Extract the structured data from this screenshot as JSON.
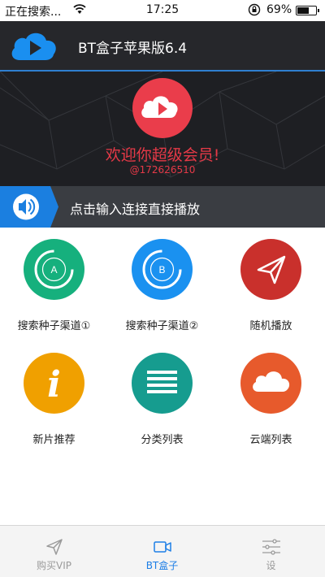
{
  "status_bar": {
    "carrier": "正在搜索...",
    "time": "17:25",
    "battery_text": "69%",
    "battery_level": 0.69
  },
  "header": {
    "title": "BT盒子苹果版6.4",
    "logo_icon": "cloud-play-icon"
  },
  "banner": {
    "welcome": "欢迎你超级会员!",
    "handle": "@172626510",
    "badge_icon": "cloud-play-icon"
  },
  "input_bar": {
    "prompt": "点击输入连接直接播放",
    "icon": "speaker-icon"
  },
  "grid": {
    "items": [
      {
        "label": "搜索种子渠道①",
        "icon": "channel-a-icon",
        "glyph": "A",
        "color": "#16b07d"
      },
      {
        "label": "搜索种子渠道②",
        "icon": "channel-b-icon",
        "glyph": "B",
        "color": "#1a91f0"
      },
      {
        "label": "随机播放",
        "icon": "paper-plane-icon",
        "glyph": "",
        "color": "#c9302c"
      },
      {
        "label": "新片推荐",
        "icon": "info-icon",
        "glyph": "i",
        "color": "#f0a000"
      },
      {
        "label": "分类列表",
        "icon": "list-icon",
        "glyph": "",
        "color": "#169c8f"
      },
      {
        "label": "云端列表",
        "icon": "cloud-icon",
        "glyph": "",
        "color": "#e75a2c"
      }
    ]
  },
  "tabbar": {
    "tabs": [
      {
        "label": "购买VIP",
        "icon": "send-icon"
      },
      {
        "label": "BT盒子",
        "icon": "video-camera-icon"
      },
      {
        "label": "设",
        "icon": "sliders-icon"
      }
    ],
    "active_index": 1,
    "active_color": "#1c7ee6"
  },
  "colors": {
    "header_bg": "#26272b",
    "accent_blue": "#2f7fd0",
    "banner_text": "#e53947"
  }
}
